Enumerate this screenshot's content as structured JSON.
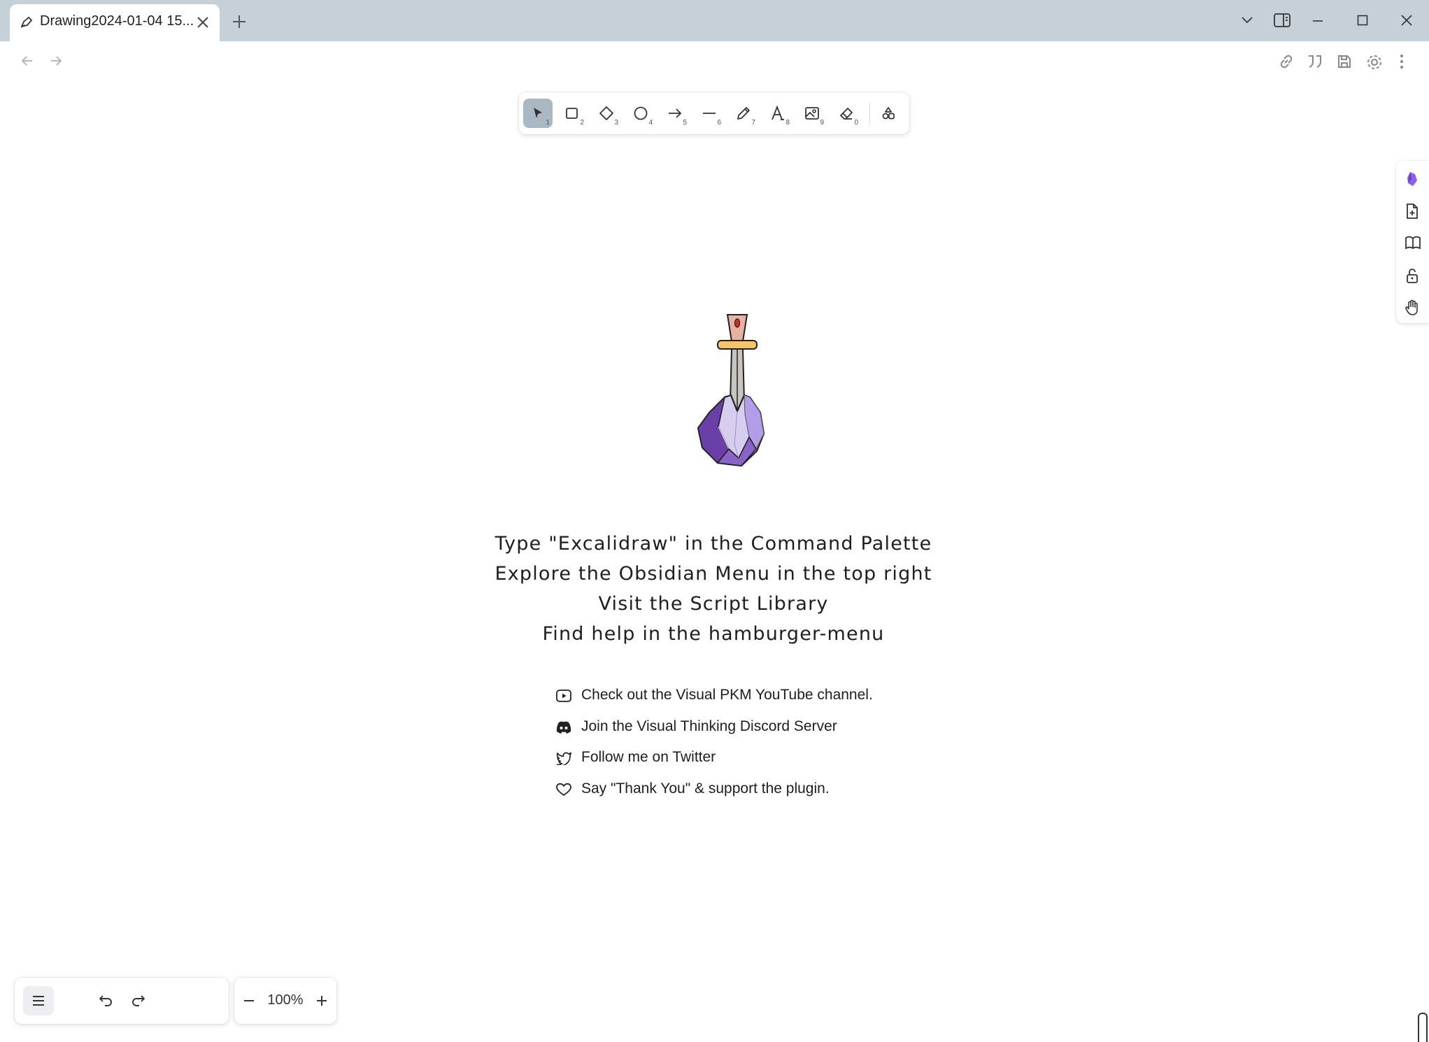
{
  "tab": {
    "title": "Drawing2024-01-04 15...",
    "icon": "excalidraw-pen-icon"
  },
  "window_controls": [
    "tab-list-chevron-icon",
    "split-view-icon",
    "minimize-icon",
    "maximize-icon",
    "close-icon"
  ],
  "nav": [
    "back-arrow-icon",
    "forward-arrow-icon"
  ],
  "view_actions": [
    "link-icon",
    "quote-icon",
    "save-icon",
    "settings-icon",
    "more-options-icon"
  ],
  "tools": [
    {
      "name": "selection",
      "icon": "pointer-icon",
      "key": "1"
    },
    {
      "name": "rectangle",
      "icon": "rectangle-icon",
      "key": "2"
    },
    {
      "name": "diamond",
      "icon": "diamond-icon",
      "key": "3"
    },
    {
      "name": "ellipse",
      "icon": "ellipse-icon",
      "key": "4"
    },
    {
      "name": "arrow",
      "icon": "arrow-icon",
      "key": "5"
    },
    {
      "name": "line",
      "icon": "line-icon",
      "key": "6"
    },
    {
      "name": "draw",
      "icon": "pencil-icon",
      "key": "7"
    },
    {
      "name": "text",
      "icon": "text-icon",
      "key": "8"
    },
    {
      "name": "image",
      "icon": "image-icon",
      "key": "9"
    },
    {
      "name": "eraser",
      "icon": "eraser-icon",
      "key": "0"
    },
    {
      "name": "more-shapes",
      "icon": "shapes-icon",
      "key": ""
    }
  ],
  "side_rail": [
    "obsidian-logo-icon",
    "new-file-icon",
    "library-book-icon",
    "unlock-icon",
    "hand-pan-icon"
  ],
  "welcome": {
    "lines": [
      "Type \"Excalidraw\" in the Command Palette",
      "Explore the Obsidian Menu in the top right",
      "Visit the Script Library",
      "Find help in the hamburger-menu"
    ],
    "links": [
      {
        "icon": "youtube-icon",
        "text": "Check out the Visual PKM YouTube channel."
      },
      {
        "icon": "discord-icon",
        "text": "Join the Visual Thinking Discord Server"
      },
      {
        "icon": "twitter-icon",
        "text": "Follow me on Twitter"
      },
      {
        "icon": "heart-icon",
        "text": "Say \"Thank You\" & support the plugin."
      }
    ]
  },
  "footer": {
    "menu_icon": "hamburger-menu-icon",
    "undo_icon": "undo-icon",
    "redo_icon": "redo-icon",
    "zoom": "100%"
  },
  "colors": {
    "titlebar": "#c5d0d8",
    "active_tool": "#a9b8c3",
    "purple_dark": "#6a3fa8",
    "purple_light": "#d7cdee"
  }
}
